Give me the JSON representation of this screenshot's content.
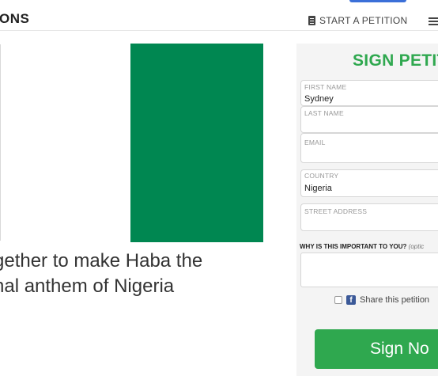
{
  "header": {
    "brand": "ONS",
    "start_petition": "START A PETITION",
    "start_icon": "document-icon",
    "menu_icon": "list-menu-icon"
  },
  "main": {
    "image": {
      "description_icon": "nigeria-flag-image",
      "color": "#008751"
    },
    "headline_lines": [
      "gether to make Haba the",
      "nal anthem of Nigeria"
    ]
  },
  "form": {
    "title": "SIGN PETIT",
    "first_name": {
      "label": "FIRST NAME",
      "value": "Sydney"
    },
    "last_name": {
      "label": "LAST NAME",
      "value": ""
    },
    "email": {
      "label": "EMAIL",
      "value": ""
    },
    "country": {
      "label": "COUNTRY",
      "value": "Nigeria"
    },
    "street_address": {
      "label": "STREET ADDRESS",
      "value": ""
    },
    "why_label": "WHY IS THIS IMPORTANT TO YOU?",
    "why_optional": "(optic",
    "share_label": "Share this petition",
    "sign_button": "Sign No",
    "accent_color": "#2fa84f"
  }
}
